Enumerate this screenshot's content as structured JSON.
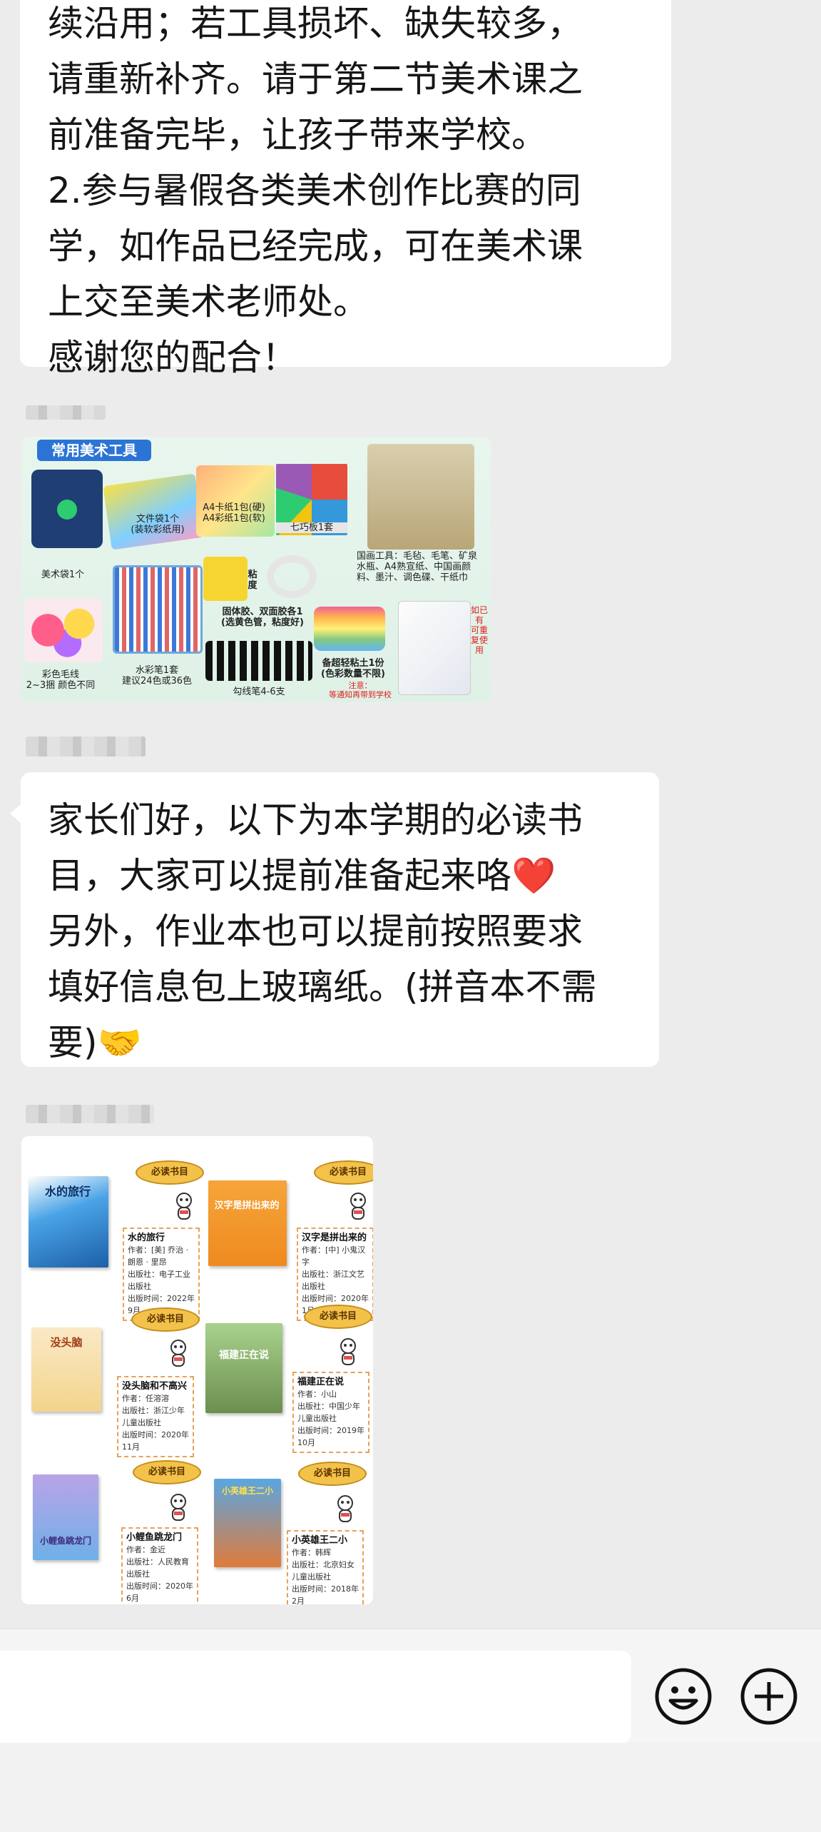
{
  "messages": {
    "top_message": {
      "lines": [
        "续沿用；若工具损坏、缺失较多，",
        "请重新补齐。请于第二节美术课之",
        "前准备完毕，让孩子带来学校。",
        "2.参与暑假各类美术创作比赛的同",
        "学，如作品已经完成，可在美术课",
        "上交至美术老师处。",
        "感谢您的配合！"
      ]
    },
    "tools_image": {
      "tag": "常用美术工具",
      "labels": {
        "bag": "美术袋1个",
        "folder": "文件袋1个\n(装软彩纸用)",
        "paper": "A4卡纸1包(硬)\nA4彩纸1包(软)",
        "tangram": "七巧板1套",
        "chinese_painting": "国画工具：毛毡、毛笔、矿泉\n水瓶、A4熟宣纸、中国画颜\n料、墨汁、调色碟、干纸巾",
        "yarn": "彩色毛线\n2~3捆 颜色不同",
        "watercolor": "水彩笔1套\n建议24色或36色",
        "glue": "固体胶、双面胶各1\n(选黄色管，粘度好)",
        "markers": "勾线笔4-6支",
        "clay": "备超轻粘土1份\n(色彩数量不限)",
        "clay_note": "注意：\n等通知再带到学校",
        "reuse_note": "如已有\n可重复使用",
        "glue_sign": "粘\n度"
      }
    },
    "middle_message": {
      "lines": [
        "家长们好，以下为本学期的必读书",
        "目，大家可以提前准备起来咯",
        "另外，作业本也可以提前按照要求",
        "填好信息包上玻璃纸。(拼音本不需",
        "要)"
      ],
      "emoji_heart": "❤️",
      "emoji_handshake": "🤝"
    },
    "books_image": {
      "badge": "必读书目",
      "books": [
        {
          "title": "水的旅行",
          "meta": [
            "作者：[美] 乔治 · 朗恩 · 里昂",
            "出版社：电子工业出版社",
            "出版时间：2022年9月"
          ],
          "cover_text": "水的旅行"
        },
        {
          "title": "汉字是拼出来的",
          "meta": [
            "作者：[中] 小鬼汉字",
            "出版社：浙江文艺出版社",
            "出版时间：2020年1月"
          ],
          "cover_text": "汉字是拼出来的"
        },
        {
          "title": "没头脑和不高兴",
          "meta": [
            "作者：任溶溶",
            "出版社：浙江少年儿童出版社",
            "出版时间：2020年11月"
          ],
          "cover_text": "没头脑"
        },
        {
          "title": "福建正在说",
          "meta": [
            "作者：小山",
            "出版社：中国少年儿童出版社",
            "出版时间：2019年10月"
          ],
          "cover_text": "福建正在说"
        },
        {
          "title": "小鲤鱼跳龙门",
          "meta": [
            "作者：金近",
            "出版社：人民教育出版社",
            "出版时间：2020年6月"
          ],
          "cover_text": "小鲤鱼跳龙门"
        },
        {
          "title": "小英雄王二小",
          "meta": [
            "作者：韩辉",
            "出版社：北京妇女儿童出版社",
            "出版时间：2018年2月"
          ],
          "cover_text": "小英雄王二小"
        }
      ]
    }
  },
  "icons": {
    "emoji_button": "smiley-icon",
    "add_button": "plus-icon"
  },
  "colors": {
    "chat_background": "#ececec",
    "bubble": "#ffffff",
    "badge": "#f3c24a"
  }
}
